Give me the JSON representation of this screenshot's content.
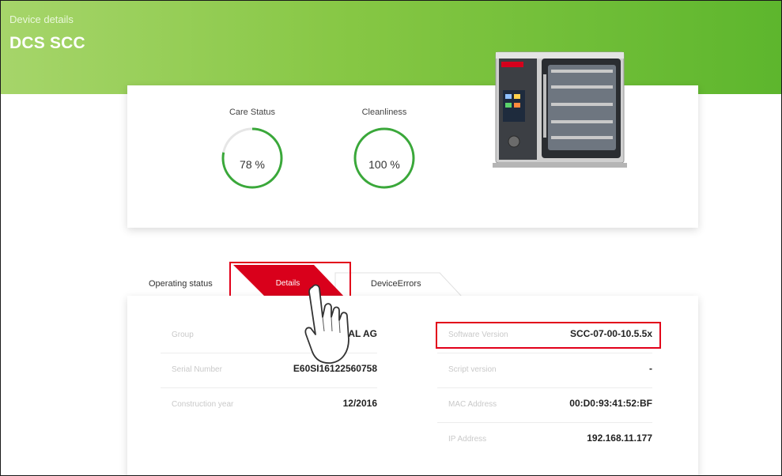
{
  "header": {
    "breadcrumb": "Device details",
    "title": "DCS SCC"
  },
  "status_card": {
    "care_status": {
      "label": "Care Status",
      "value_text": "78 %",
      "percent": 78
    },
    "cleanliness": {
      "label": "Cleanliness",
      "value_text": "100 %",
      "percent": 100
    },
    "gauge_color": "#3aa83a",
    "gauge_track_color": "#e6e6e6"
  },
  "tabs": [
    {
      "label": "Operating status",
      "active": false
    },
    {
      "label": "Details",
      "active": true
    },
    {
      "label": "DeviceErrors",
      "active": false
    }
  ],
  "details": {
    "left": [
      {
        "label": "Group",
        "value": "ONAL AG"
      },
      {
        "label": "Serial Number",
        "value": "E60SI16122560758"
      },
      {
        "label": "Construction year",
        "value": "12/2016"
      }
    ],
    "right": [
      {
        "label": "Software Version",
        "value": "SCC-07-00-10.5.5x"
      },
      {
        "label": "Script version",
        "value": "-"
      },
      {
        "label": "MAC Address",
        "value": "00:D0:93:41:52:BF"
      },
      {
        "label": "IP Address",
        "value": "192.168.11.177"
      }
    ]
  },
  "colors": {
    "accent_red": "#e2001a",
    "header_green": "#6dbd35"
  },
  "icons": [
    "appliance-image",
    "pointing-hand-icon"
  ]
}
